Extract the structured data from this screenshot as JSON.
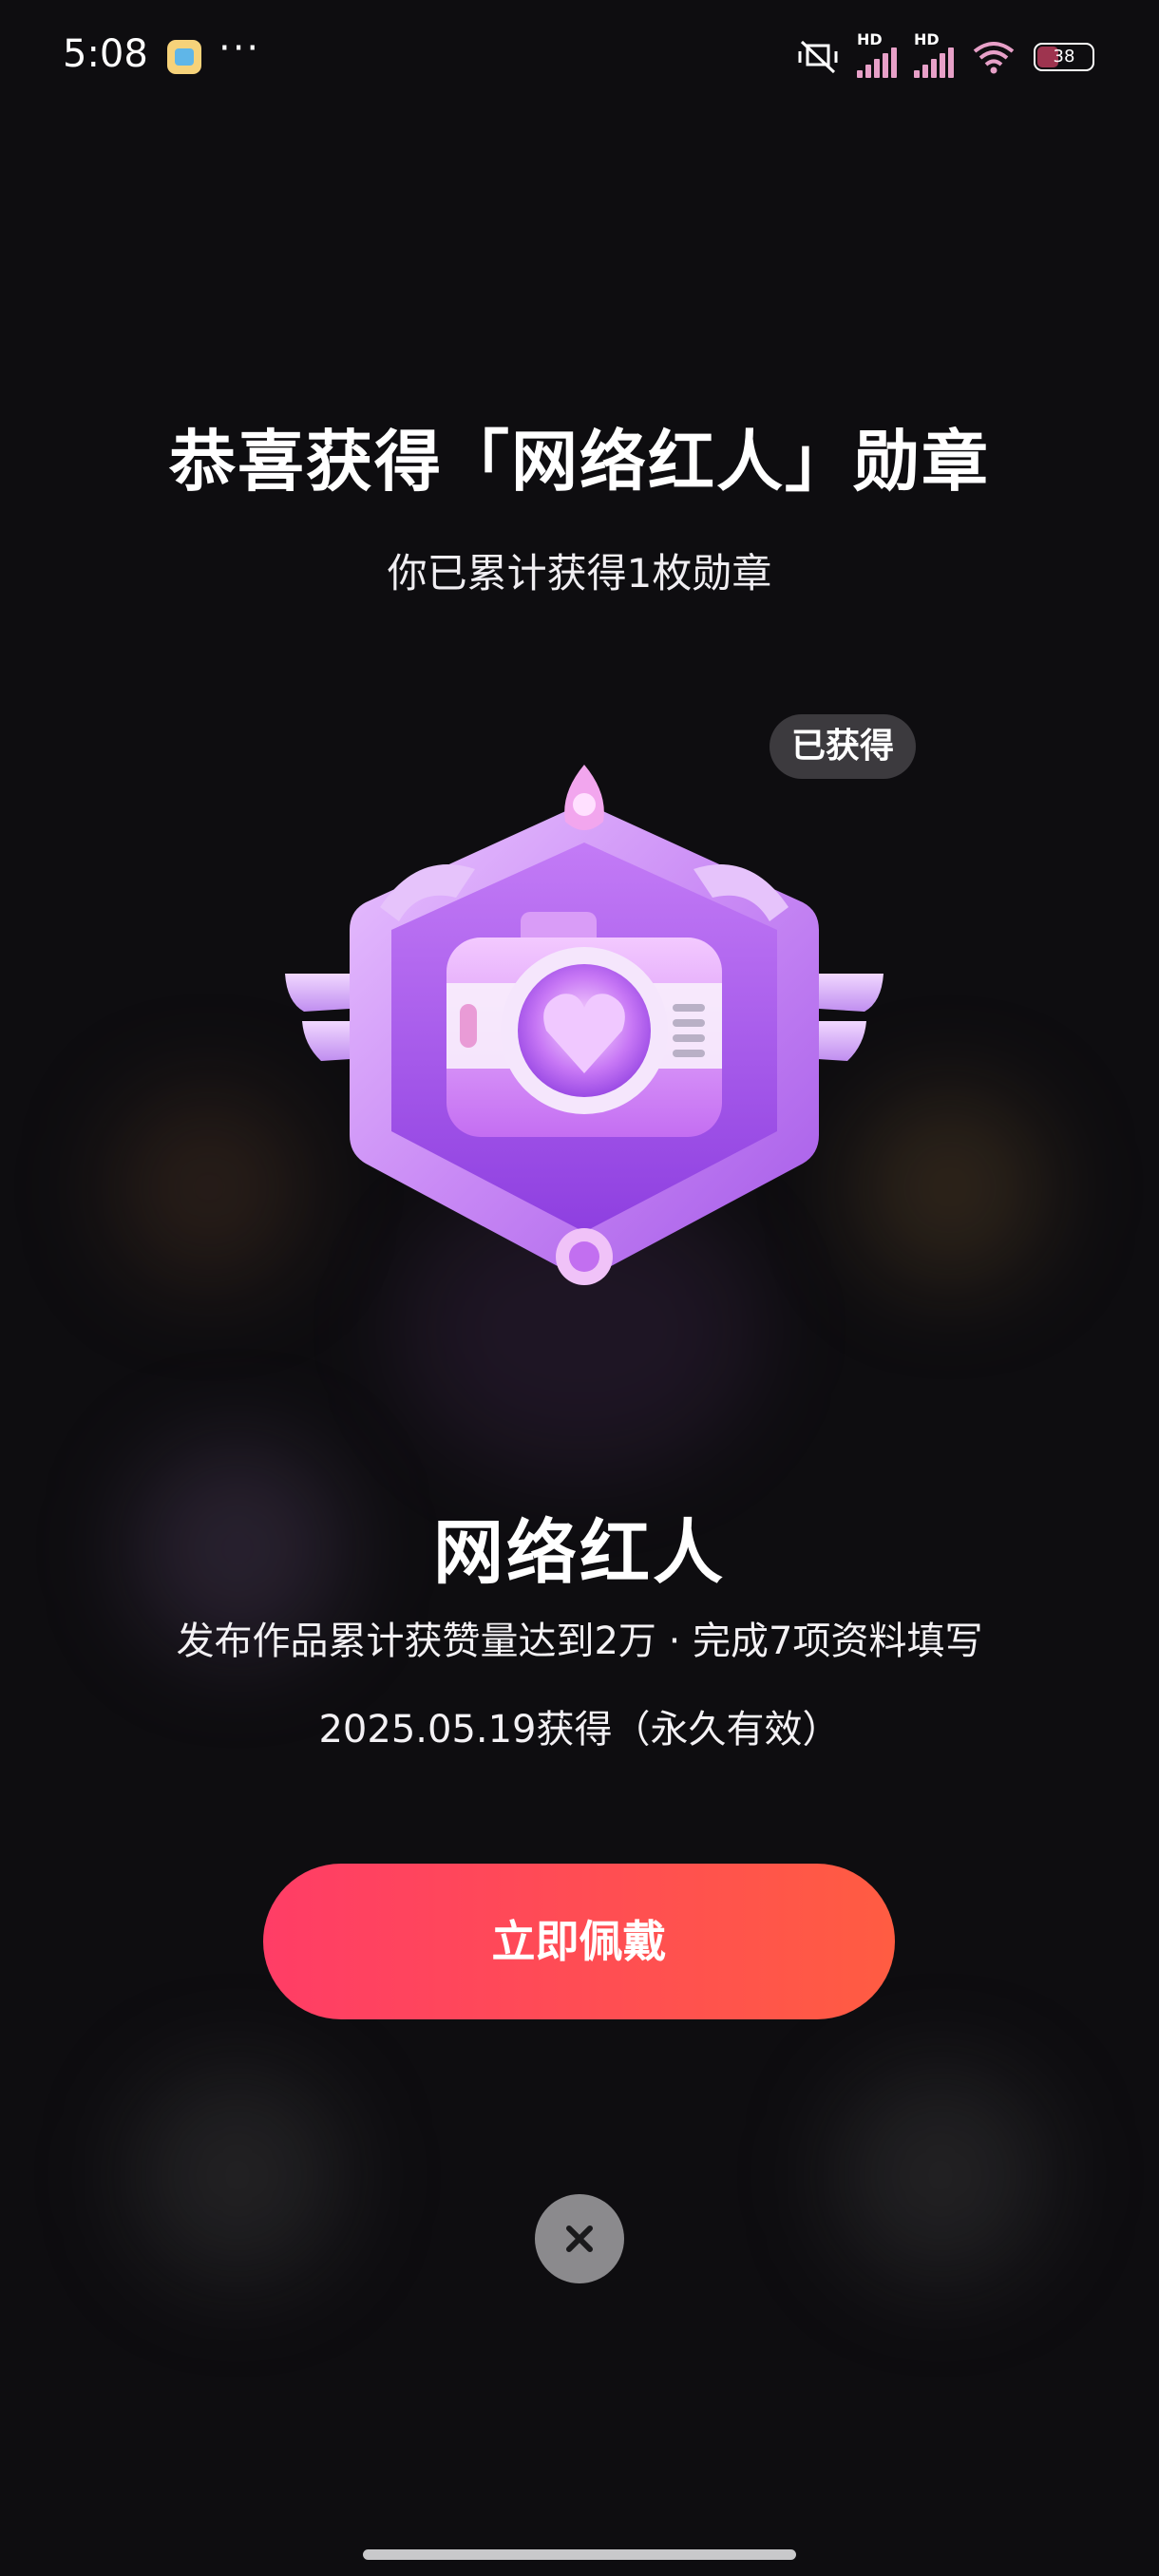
{
  "status_bar": {
    "time": "5:08",
    "more": "···",
    "signal_1_label": "HD",
    "signal_2_label": "HD",
    "battery": "38"
  },
  "dialog": {
    "title": "恭喜获得「网络红人」勋章",
    "subtitle": "你已累计获得1枚勋章",
    "status_tag": "已获得",
    "badge_icon": "purple-camera-badge-icon",
    "badge_name": "网络红人",
    "badge_description": "发布作品累计获赞量达到2万 · 完成7项资料填写",
    "obtained_date": "2025.05.19获得（永久有效）",
    "wear_button_label": "立即佩戴",
    "close_icon": "close-icon"
  },
  "colors": {
    "background": "#0e0d10",
    "button_gradient_start": "#ff3d66",
    "button_gradient_end": "#ff5c42",
    "badge_purple": "#b35bf0"
  }
}
